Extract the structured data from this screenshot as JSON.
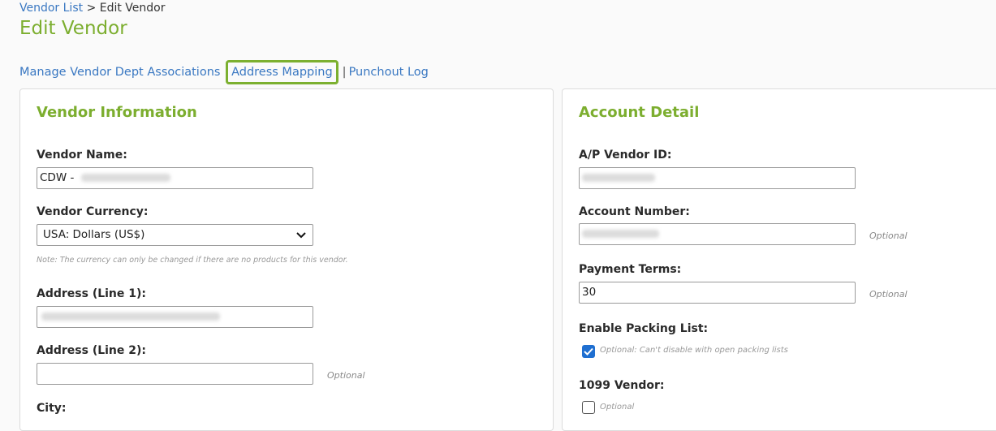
{
  "breadcrumb": {
    "link": "Vendor List",
    "separator": ">",
    "current": "Edit Vendor"
  },
  "page_title": "Edit Vendor",
  "links": [
    {
      "label": "Manage Vendor Dept Associations"
    },
    {
      "label": "Address Mapping"
    },
    {
      "label": "Punchout Log"
    }
  ],
  "vendor_info": {
    "heading": "Vendor Information",
    "vendor_name": {
      "label": "Vendor Name:",
      "value": "CDW -"
    },
    "vendor_currency": {
      "label": "Vendor Currency:",
      "value": "USA: Dollars (US$)"
    },
    "currency_note": "Note: The currency can only be changed if there are no products for this vendor.",
    "address1": {
      "label": "Address (Line 1):",
      "value": ""
    },
    "address2": {
      "label": "Address (Line 2):",
      "value": "",
      "optional": "Optional"
    },
    "city": {
      "label": "City:"
    }
  },
  "account_detail": {
    "heading": "Account Detail",
    "ap_vendor_id": {
      "label": "A/P Vendor ID:",
      "value": ""
    },
    "account_number": {
      "label": "Account Number:",
      "value": "",
      "optional": "Optional"
    },
    "payment_terms": {
      "label": "Payment Terms:",
      "value": "30",
      "optional": "Optional"
    },
    "packing_list": {
      "label": "Enable Packing List:",
      "checked": true,
      "note": "Optional: Can't disable with open packing lists"
    },
    "vendor_1099": {
      "label": "1099 Vendor:",
      "checked": false,
      "note": "Optional"
    }
  },
  "colors": {
    "accent": "#7cae2f",
    "link": "#3a78c2",
    "checkbox": "#1f6fd1"
  }
}
